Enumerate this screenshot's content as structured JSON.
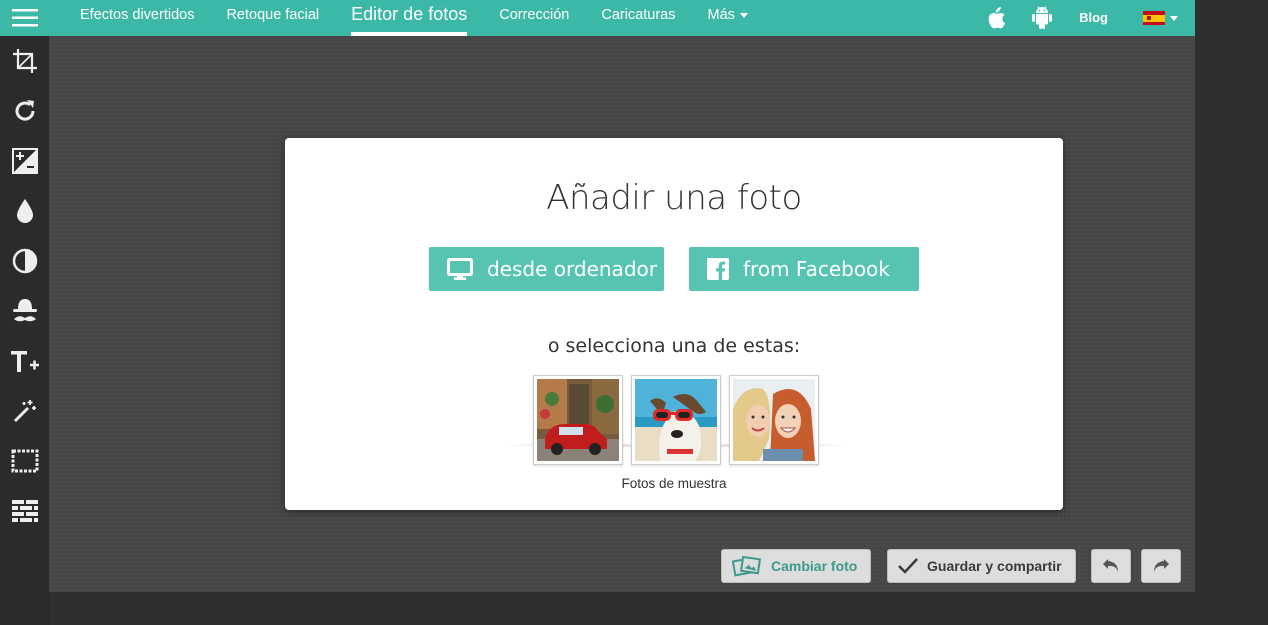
{
  "nav": {
    "items": [
      {
        "label": "Efectos divertidos"
      },
      {
        "label": "Retoque facial"
      },
      {
        "label": "Editor de fotos"
      },
      {
        "label": "Corrección"
      },
      {
        "label": "Caricaturas"
      },
      {
        "label": "Más"
      }
    ],
    "active": "Editor de fotos",
    "blog_label": "Blog",
    "accent_color": "#3bb9a6"
  },
  "sidebar": {
    "tools": [
      "crop-icon",
      "rotate-icon",
      "exposure-icon",
      "color-drop-icon",
      "contrast-icon",
      "mask-icon",
      "text-add-icon",
      "magic-wand-icon",
      "frame-icon",
      "texture-icon"
    ]
  },
  "modal": {
    "title": "Añadir una foto",
    "from_computer_label": "desde ordenador",
    "from_facebook_label": "from Facebook",
    "or_text": "o selecciona una de estas:",
    "samples_label": "Fotos de muestra",
    "button_color": "#56c4b1"
  },
  "toolbar": {
    "change_photo_label": "Cambiar foto",
    "save_share_label": "Guardar y compartir"
  }
}
